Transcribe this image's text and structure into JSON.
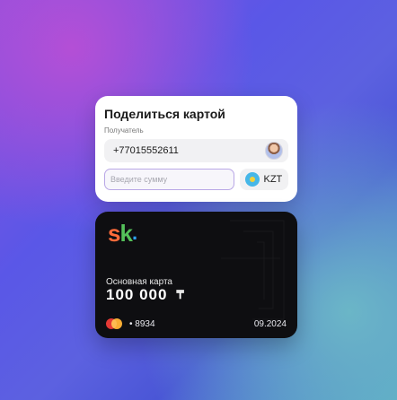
{
  "share": {
    "title": "Поделиться картой",
    "recipient_label": "Получатель",
    "recipient_phone": "+77015552611",
    "amount_placeholder": "Введите сумму",
    "currency": "KZT"
  },
  "card": {
    "brand_logo": {
      "text_s": "s",
      "text_k": "k",
      "text_dot": "."
    },
    "title": "Основная карта",
    "balance": "100 000",
    "currency_symbol": "₸",
    "masked_number": "• 8934",
    "expiry": "09.2024",
    "payment_network_icon": "mastercard-icon"
  },
  "colors": {
    "accent_border": "#b9a7e6",
    "card_background": "#0e0e11"
  }
}
